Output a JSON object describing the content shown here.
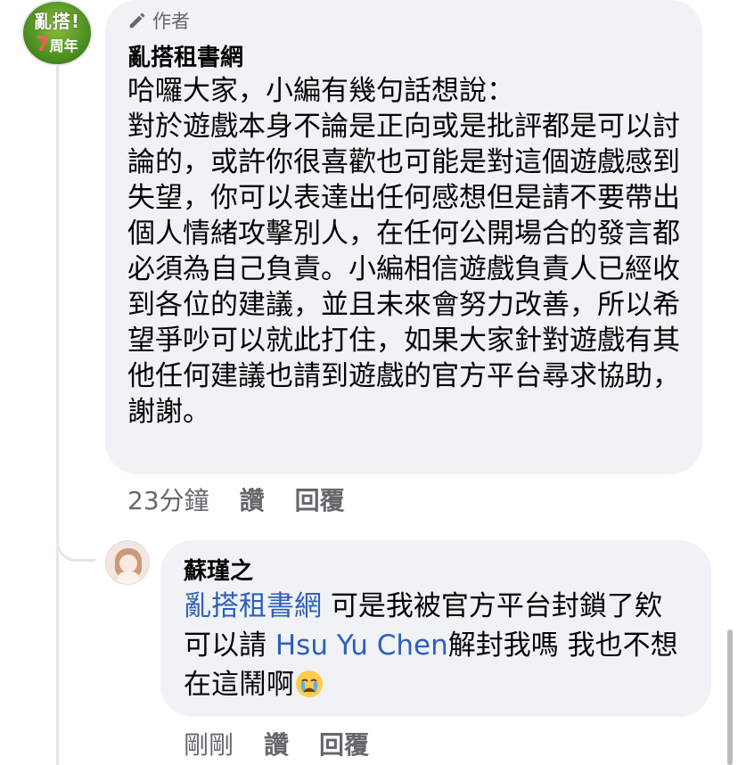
{
  "main_comment": {
    "avatar": {
      "line1": "亂搭!",
      "number": "7",
      "line2": "周年"
    },
    "badge_label": "作者",
    "author": "亂搭租書網",
    "text": "哈囉大家，小編有幾句話想說：\n對於遊戲本身不論是正向或是批評都是可以討論的，或許你很喜歡也可能是對這個遊戲感到失望，你可以表達出任何感想但是請不要帶出個人情緒攻擊別人，在任何公開場合的發言都必須為自己負責。小編相信遊戲負責人已經收到各位的建議，並且未來會努力改善，所以希望爭吵可以就此打住，如果大家針對遊戲有其他任何建議也請到遊戲的官方平台尋求協助，謝謝。",
    "timestamp": "23分鐘",
    "like_label": "讚",
    "reply_label": "回覆"
  },
  "reply_comment": {
    "author": "蘇瑾之",
    "mention1": "亂搭租書網",
    "text1": " 可是我被官方平台封鎖了欸 可以請 ",
    "mention2": "Hsu Yu Chen",
    "text2": "解封我嗎 我也不想在這鬧啊",
    "emoji_icon": "crying-face-emoji",
    "timestamp": "剛剛",
    "like_label": "讚",
    "reply_label": "回覆"
  },
  "colors": {
    "bubble": "#f0f2f5",
    "mention": "#2d5fba",
    "secondary_text": "#65676b"
  }
}
